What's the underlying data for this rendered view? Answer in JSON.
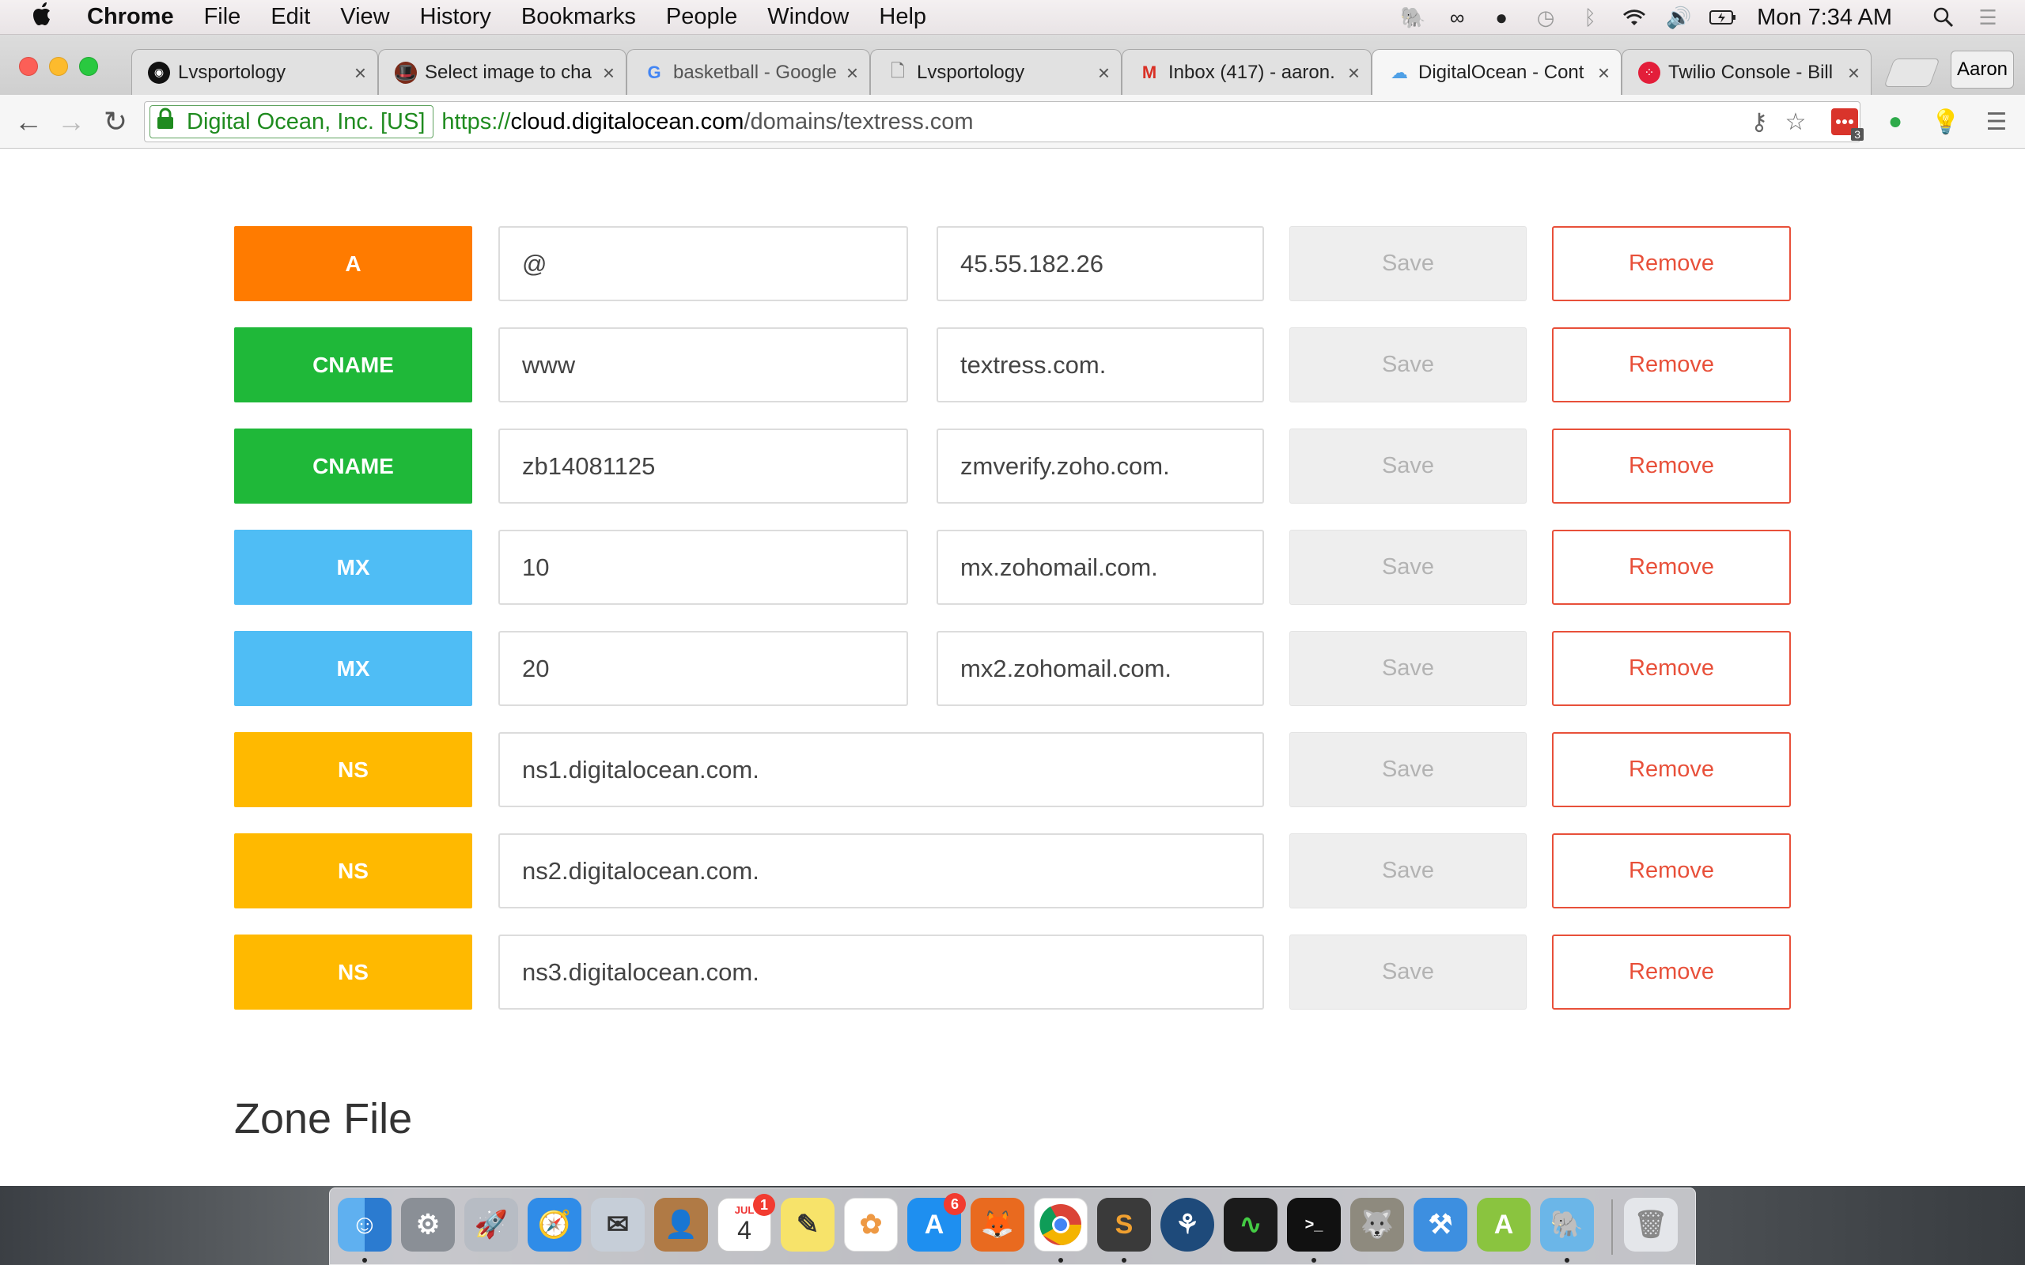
{
  "menubar": {
    "app": "Chrome",
    "items": [
      "File",
      "Edit",
      "View",
      "History",
      "Bookmarks",
      "People",
      "Window",
      "Help"
    ],
    "clock": "Mon 7:34 AM"
  },
  "tabs": [
    {
      "title": "Lvsportology",
      "icon": "lvsportology-favicon"
    },
    {
      "title": "Select image to cha",
      "icon": "spy-favicon"
    },
    {
      "title": "basketball - Google",
      "icon": "google-favicon"
    },
    {
      "title": "Lvsportology",
      "icon": "document-favicon"
    },
    {
      "title": "Inbox (417) - aaron.",
      "icon": "gmail-favicon"
    },
    {
      "title": "DigitalOcean - Cont",
      "icon": "digitalocean-favicon"
    },
    {
      "title": "Twilio Console - Bill",
      "icon": "twilio-favicon"
    }
  ],
  "profile": "Aaron",
  "omnibox": {
    "ev_label": "Digital Ocean, Inc. [US]",
    "scheme": "https://",
    "host": "cloud.digitalocean.com",
    "path": "/domains/textress.com"
  },
  "extensions": {
    "badge_count": "3"
  },
  "records": [
    {
      "type": "A",
      "name": "@",
      "value": "45.55.182.26",
      "color": "#ff7b00"
    },
    {
      "type": "CNAME",
      "name": "www",
      "value": "textress.com.",
      "color": "#1fb839"
    },
    {
      "type": "CNAME",
      "name": "zb14081125",
      "value": "zmverify.zoho.com.",
      "color": "#1fb839"
    },
    {
      "type": "MX",
      "name": "10",
      "value": "mx.zohomail.com.",
      "color": "#4fbdf5"
    },
    {
      "type": "MX",
      "name": "20",
      "value": "mx2.zohomail.com.",
      "color": "#4fbdf5"
    },
    {
      "type": "NS",
      "value": "ns1.digitalocean.com.",
      "color": "#ffb900"
    },
    {
      "type": "NS",
      "value": "ns2.digitalocean.com.",
      "color": "#ffb900"
    },
    {
      "type": "NS",
      "value": "ns3.digitalocean.com.",
      "color": "#ffb900"
    }
  ],
  "buttons": {
    "save": "Save",
    "remove": "Remove"
  },
  "zone_file_title": "Zone File",
  "dock": {
    "calendar_month": "JUL",
    "calendar_day": "4",
    "calendar_badge": "1",
    "appstore_badge": "6"
  }
}
